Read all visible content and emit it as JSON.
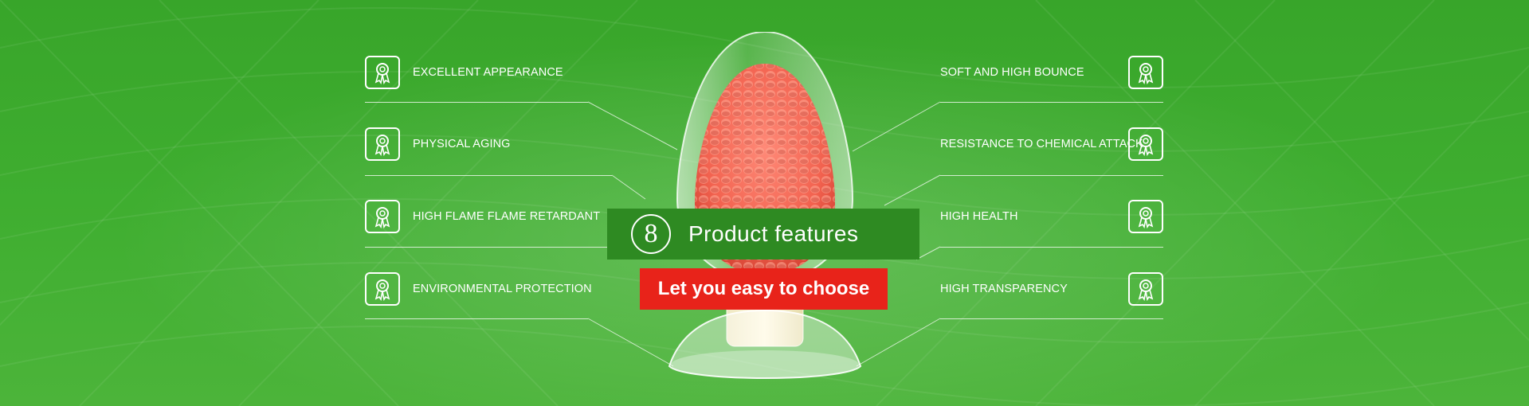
{
  "features_left": [
    {
      "label": "EXCELLENT APPEARANCE",
      "icon": "award-ribbon-icon"
    },
    {
      "label": "PHYSICAL AGING",
      "icon": "award-ribbon-icon"
    },
    {
      "label": "HIGH FLAME FLAME RETARDANT",
      "icon": "award-ribbon-icon"
    },
    {
      "label": "ENVIRONMENTAL PROTECTION",
      "icon": "award-ribbon-icon"
    }
  ],
  "features_right": [
    {
      "label": "SOFT AND HIGH BOUNCE",
      "icon": "award-ribbon-icon"
    },
    {
      "label": "RESISTANCE TO CHEMICAL ATTACK",
      "icon": "award-ribbon-icon"
    },
    {
      "label": "HIGH HEALTH",
      "icon": "award-ribbon-icon"
    },
    {
      "label": "HIGH TRANSPARENCY",
      "icon": "award-ribbon-icon"
    }
  ],
  "headline": {
    "number": "8",
    "title": "Product features",
    "cta_label": "Let you easy to choose"
  },
  "colors": {
    "background": "#3fae30",
    "title_box": "#2e8a22",
    "cta": "#e8231a",
    "pellets": "#f2624f"
  }
}
